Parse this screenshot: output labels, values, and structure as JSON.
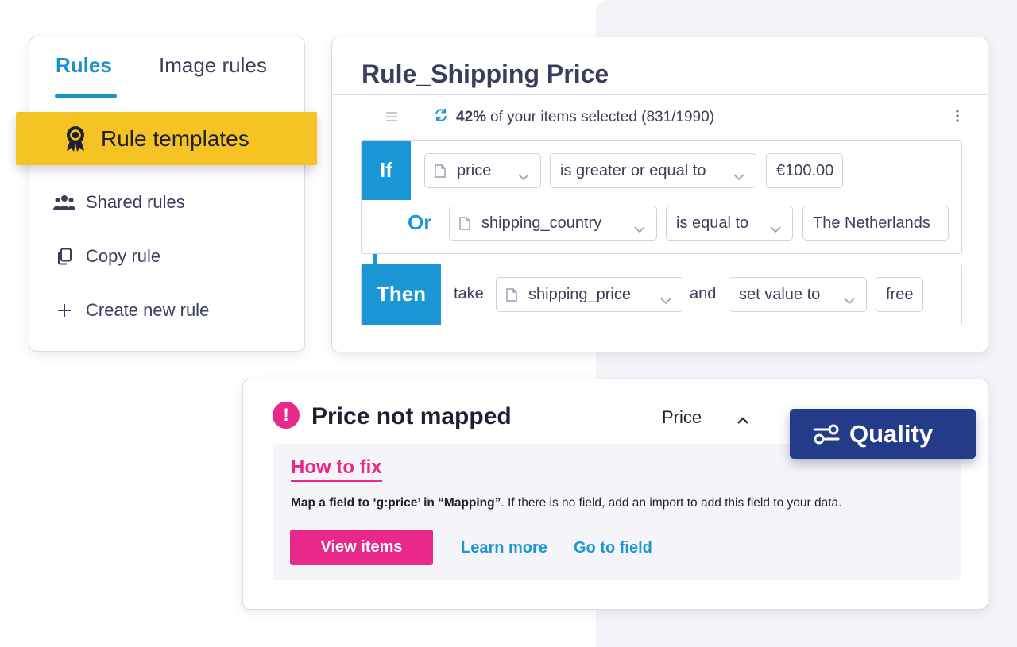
{
  "rules_panel": {
    "tabs": [
      {
        "label": "Rules",
        "active": true
      },
      {
        "label": "Image rules",
        "active": false
      }
    ],
    "templates_banner": {
      "label": "Rule templates",
      "icon": "award-icon"
    },
    "menu": [
      {
        "label": "Shared rules",
        "icon": "users-icon"
      },
      {
        "label": "Copy rule",
        "icon": "copy-icon"
      },
      {
        "label": "Create new rule",
        "icon": "plus-icon"
      }
    ]
  },
  "rule": {
    "title": "Rule_Shipping Price",
    "selection": {
      "percent": "42%",
      "text": "of your items selected (831/1990)"
    },
    "if_label": "If",
    "or_label": "Or",
    "then_label": "Then",
    "conditions": [
      {
        "field": "price",
        "operator": "is greater or equal to",
        "value": "€100.00"
      },
      {
        "field": "shipping_country",
        "operator": "is equal to",
        "value": "The Netherlands"
      }
    ],
    "action": {
      "take_label": "take",
      "field": "shipping_price",
      "and_label": "and",
      "operation": "set value to",
      "value": "free"
    }
  },
  "issue": {
    "alert_symbol": "!",
    "title": "Price not mapped",
    "field": "Price",
    "fix_title": "How to fix",
    "fix_bold": "Map a field to ‘g:price’ in “Mapping”",
    "fix_rest": ". If there is no field, add an import to add this field to your data.",
    "view_button": "View items",
    "learn_more": "Learn more",
    "go_to_field": "Go to field"
  },
  "quality_badge": {
    "label": "Quality",
    "icon": "sliders-icon"
  },
  "colors": {
    "accent_blue": "#1b97d6",
    "tab_blue": "#1b8fd0",
    "banner_yellow": "#f5c323",
    "alert_pink": "#e8298a",
    "badge_navy": "#243b8a",
    "text_dark": "#3a3d5c"
  }
}
